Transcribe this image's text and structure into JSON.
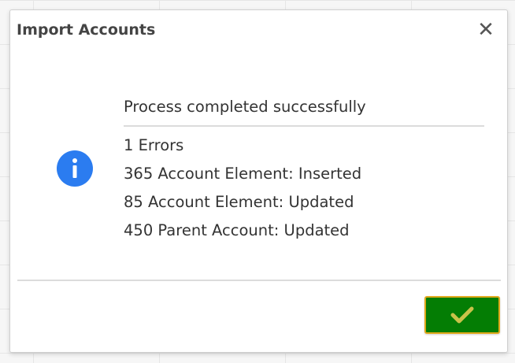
{
  "dialog": {
    "title": "Import Accounts",
    "close_label": "✕"
  },
  "message": {
    "heading": "Process completed successfully",
    "lines": [
      "1 Errors",
      "365 Account Element: Inserted",
      "85 Account Element: Updated",
      "450 Parent Account: Updated"
    ]
  },
  "icons": {
    "info": "info-icon",
    "close": "close-icon",
    "confirm": "checkmark-icon"
  },
  "colors": {
    "info_icon": "#2b7cf0",
    "ok_button_bg": "#047d04",
    "ok_button_border": "#e0a81a",
    "checkmark": "#c9c24a"
  }
}
